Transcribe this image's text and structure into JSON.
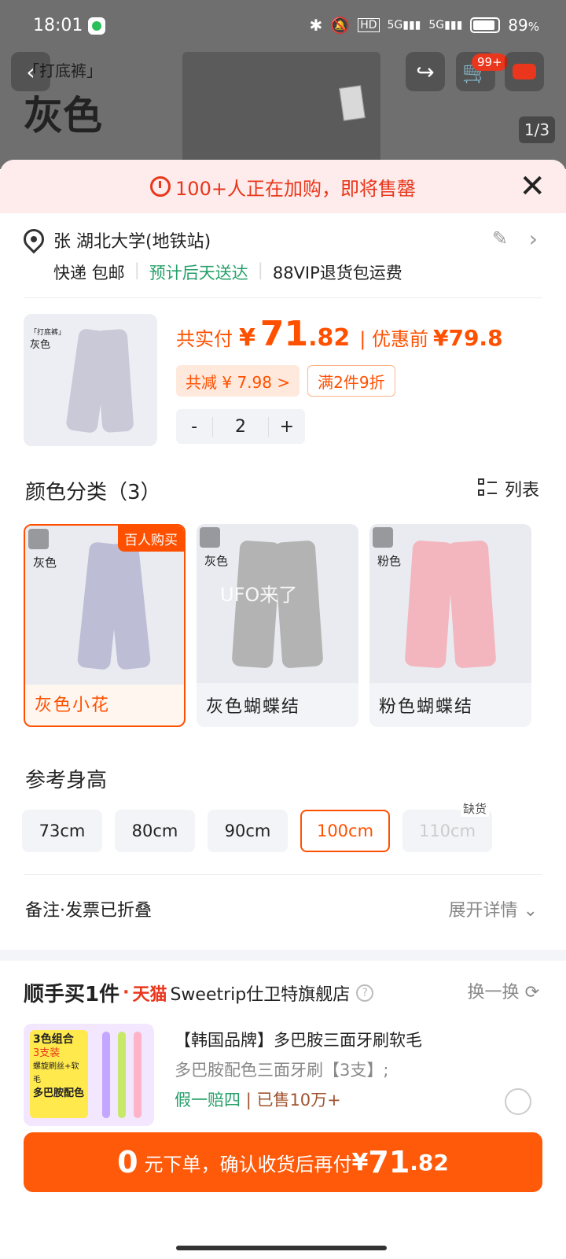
{
  "status_bar": {
    "time": "18:01",
    "battery": "89",
    "battery_unit": "%",
    "network": "5G"
  },
  "background": {
    "subtitle": "「打底裤」",
    "title": "灰色",
    "pager": "1/3",
    "cart_badge": "99+"
  },
  "banner": {
    "text": "100+人正在加购，即将售罄"
  },
  "address": {
    "text": "张 湖北大学(地铁站)",
    "delivery": "快递 包邮",
    "eta": "预计后天送达",
    "vip": "88VIP退货包运费"
  },
  "product": {
    "thumb_subtitle": "「打底裤」",
    "thumb_title": "灰色",
    "pay_label": "共实付",
    "currency": "¥",
    "price_int": "71",
    "price_dec": ".82",
    "orig_label": "| 优惠前",
    "orig_price": "¥79.8",
    "discount_chip": "共减 ¥ 7.98 >",
    "promo_chip": "满2件9折",
    "qty_minus": "-",
    "qty": "2",
    "qty_plus": "+"
  },
  "colors": {
    "title": "颜色分类（3）",
    "list_label": "列表",
    "hot_tag": "百人购买",
    "watermark": "UFO来了",
    "items": [
      {
        "label": "灰色小花",
        "tag": "灰色",
        "selected": true
      },
      {
        "label": "灰色蝴蝶结",
        "tag": "灰色",
        "selected": false
      },
      {
        "label": "粉色蝴蝶结",
        "tag": "粉色",
        "selected": false
      }
    ]
  },
  "heights": {
    "title": "参考身高",
    "oos_label": "缺货",
    "items": [
      "73cm",
      "80cm",
      "90cm",
      "100cm",
      "110cm"
    ],
    "selected": "100cm",
    "unavailable": "110cm"
  },
  "note": {
    "label": "备注·发票已折叠",
    "expand": "展开详情"
  },
  "recommend": {
    "logo": "顺手买1件",
    "dot": "·",
    "tmall": "天猫",
    "store": "Sweetrip仕卫特旗舰店",
    "help": "?",
    "swap": "换一换",
    "title": "【韩国品牌】多巴胺三面牙刷软毛",
    "desc": "多巴胺配色三面牙刷【3支】;",
    "guarantee": "假一赔四",
    "sold": "| 已售10万+",
    "img_text": [
      "3色组合",
      "3支装",
      "螺旋刷丝+软毛",
      "多巴胺配色"
    ]
  },
  "cta": {
    "zero": "0",
    "text": "元下单，确认收货后再付",
    "currency": "¥",
    "price_int": "71",
    "price_dec": ".82"
  },
  "colors_theme": {
    "accent": "#ff5000",
    "cta": "#ff5a0a",
    "green": "#27a06a",
    "red": "#e9361c"
  }
}
